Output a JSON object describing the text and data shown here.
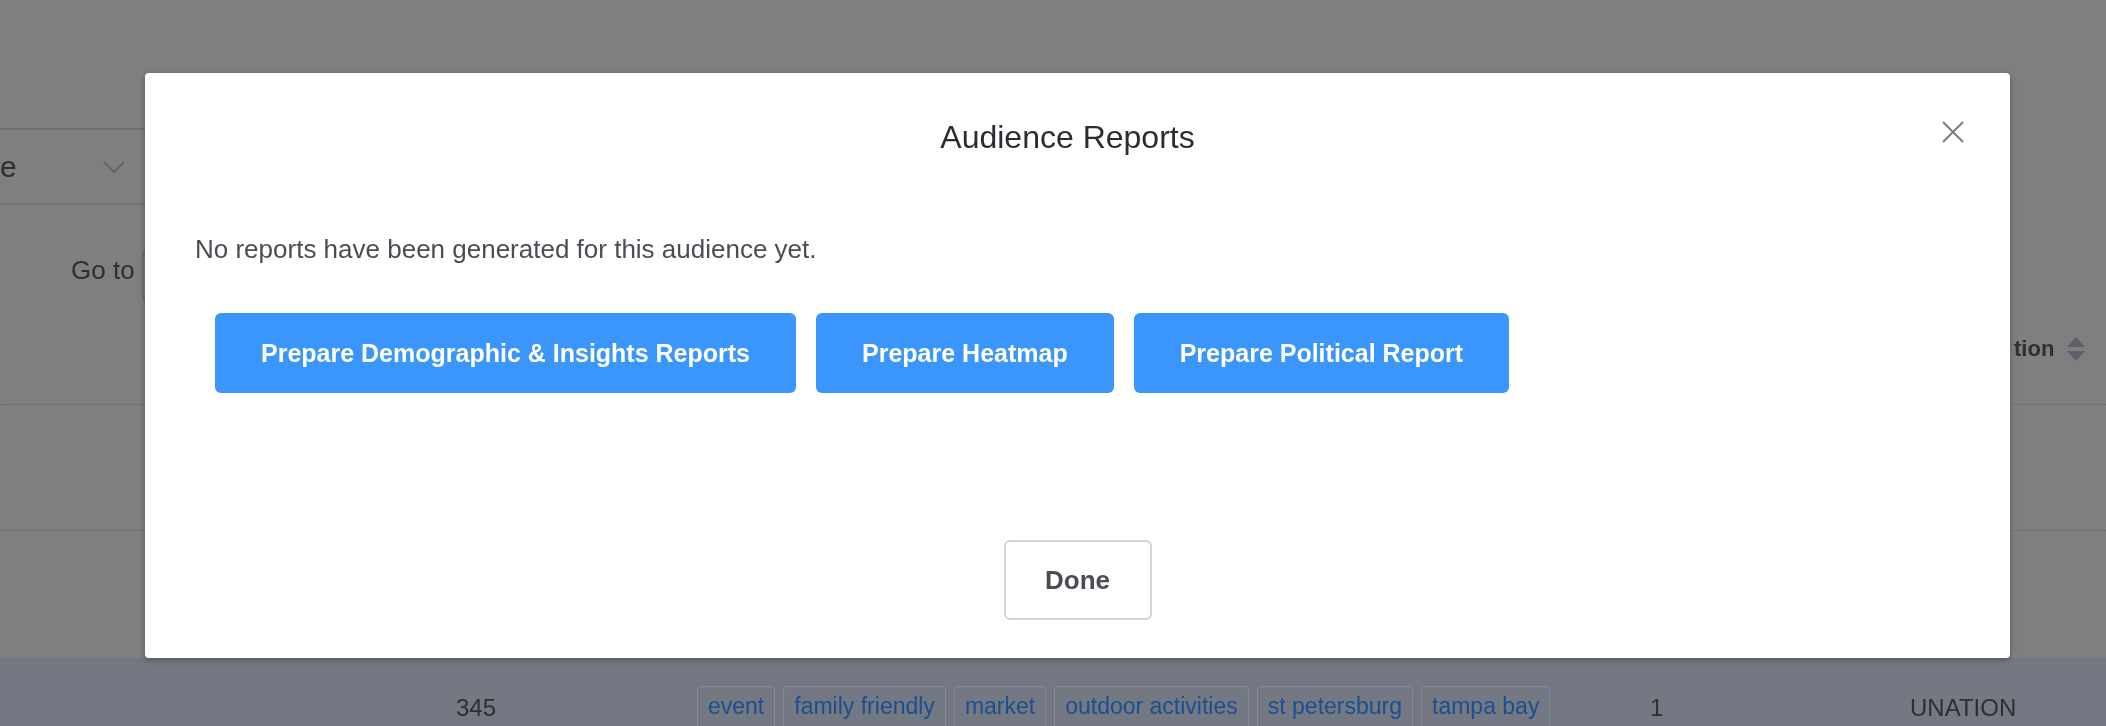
{
  "background": {
    "dropdown": {
      "value": "e"
    },
    "goto_label": "Go to",
    "column_header": "tion",
    "row": {
      "count": "345",
      "tags": [
        "event",
        "family friendly",
        "market",
        "outdoor activities",
        "st petersburg",
        "tampa bay"
      ],
      "column_3": "1",
      "column_4": "UNATION"
    }
  },
  "modal": {
    "title": "Audience Reports",
    "message": "No reports have been generated for this audience yet.",
    "actions": [
      "Prepare Demographic & Insights Reports",
      "Prepare Heatmap",
      "Prepare Political Report"
    ],
    "done": "Done"
  }
}
